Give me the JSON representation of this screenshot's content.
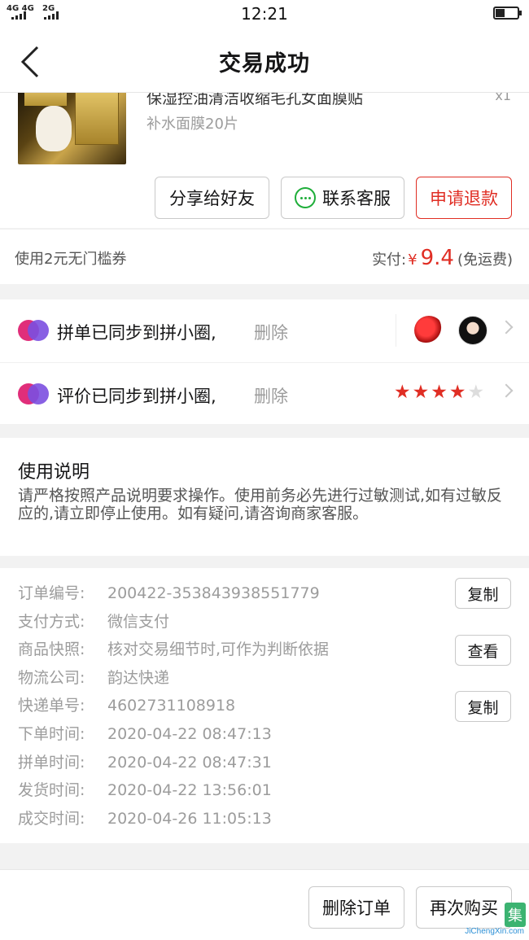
{
  "status_bar": {
    "network_1": "4G 4G",
    "network_2": "2G",
    "time": "12:21",
    "battery_level": 0.38
  },
  "header": {
    "title": "交易成功"
  },
  "product": {
    "name": "保湿控油清洁收缩毛孔女面膜贴",
    "qty": "x1",
    "spec": "补水面膜20片",
    "actions": {
      "share": "分享给好友",
      "service": "联系客服",
      "refund": "申请退款"
    }
  },
  "payment": {
    "coupon": "使用2元无门槛券",
    "paid_label": "实付:",
    "currency": "¥",
    "amount": "9.4",
    "shipping_note": "(免运费)"
  },
  "sync": {
    "group_text": "拼单已同步到拼小圈,",
    "group_delete": "删除",
    "review_text": "评价已同步到拼小圈,",
    "review_delete": "删除",
    "rating": 4,
    "rating_max": 5
  },
  "usage": {
    "title": "使用说明",
    "body": "请严格按照产品说明要求操作。使用前务必先进行过敏测试,如有过敏反应的,请立即停止使用。如有疑问,请咨询商家客服。"
  },
  "order_info": {
    "rows": [
      {
        "label": "订单编号:",
        "value": "200422-353843938551779"
      },
      {
        "label": "支付方式:",
        "value": "微信支付"
      },
      {
        "label": "商品快照:",
        "value": "核对交易细节时,可作为判断依据"
      },
      {
        "label": "物流公司:",
        "value": "韵达快递"
      },
      {
        "label": "快递单号:",
        "value": "4602731108918"
      },
      {
        "label": "下单时间:",
        "value": "2020-04-22 08:47:13"
      },
      {
        "label": "拼单时间:",
        "value": "2020-04-22 08:47:31"
      },
      {
        "label": "发货时间:",
        "value": "2020-04-22 13:56:01"
      },
      {
        "label": "成交时间:",
        "value": "2020-04-26 11:05:13"
      }
    ],
    "copy_order": "复制",
    "view_snapshot": "查看",
    "copy_tracking": "复制"
  },
  "bottom": {
    "delete_order": "删除订单",
    "buy_again": "再次购买"
  },
  "watermark": {
    "text": "JiChengXin.com"
  },
  "colors": {
    "accent": "#e02e24",
    "wechat": "#1fae3a",
    "muted": "#9c9c9c"
  }
}
